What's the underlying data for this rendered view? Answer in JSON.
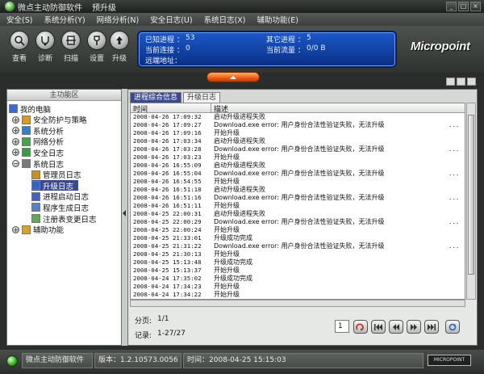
{
  "window": {
    "title": "微点主动防御软件",
    "subtitle": "预升级",
    "buttons": [
      "_",
      "□",
      "×"
    ]
  },
  "menu": [
    "安全(S)",
    "系统分析(Y)",
    "网络分析(N)",
    "安全日志(U)",
    "系统日志(X)",
    "辅助功能(E)"
  ],
  "toolbar": [
    {
      "label": "查看",
      "icon": "search-icon"
    },
    {
      "label": "诊断",
      "icon": "stethoscope-icon"
    },
    {
      "label": "扫描",
      "icon": "scan-icon"
    },
    {
      "label": "设置",
      "icon": "settings-icon"
    },
    {
      "label": "升级",
      "icon": "upgrade-icon"
    }
  ],
  "status_panel": {
    "known_label": "已知进程 ：",
    "known_value": "53",
    "other_label": "其它进程 ：",
    "other_value": "5",
    "conn_label": "当前连接 ：",
    "conn_value": "0",
    "flow_label": "当前流量 ：",
    "flow_value": "0/0 B",
    "remote_label": "远端地址："
  },
  "brand": {
    "logo": "Micropoint"
  },
  "left_panel": {
    "header": "主功能区",
    "tree": [
      {
        "label": "我的电脑",
        "level": 0,
        "expander": "",
        "color": "#3b6bd0"
      },
      {
        "label": "安全防护与策略",
        "level": 1,
        "expander": "+",
        "color": "#d89a26"
      },
      {
        "label": "系统分析",
        "level": 1,
        "expander": "+",
        "color": "#3d7ec9"
      },
      {
        "label": "网络分析",
        "level": 1,
        "expander": "+",
        "color": "#4aa34a"
      },
      {
        "label": "安全日志",
        "level": 1,
        "expander": "+",
        "color": "#3f9a44"
      },
      {
        "label": "系统日志",
        "level": 1,
        "expander": "−",
        "color": "#777a78"
      },
      {
        "label": "管理员日志",
        "level": 2,
        "expander": "",
        "color": "#c2912b"
      },
      {
        "label": "升级日志",
        "level": 2,
        "expander": "",
        "color": "#2f66c6",
        "selected": true
      },
      {
        "label": "进程启动日志",
        "level": 2,
        "expander": "",
        "color": "#4560b8"
      },
      {
        "label": "程序生成日志",
        "level": 2,
        "expander": "",
        "color": "#5a7fc2"
      },
      {
        "label": "注册表变更日志",
        "level": 2,
        "expander": "",
        "color": "#5fa55a"
      },
      {
        "label": "辅助功能",
        "level": 1,
        "expander": "+",
        "color": "#d4a32d"
      }
    ]
  },
  "tabs": [
    {
      "label": "进程综合信息",
      "active": true
    },
    {
      "label": "升级日志",
      "active": false
    }
  ],
  "grid": {
    "columns": [
      "时间",
      "描述"
    ],
    "rows": [
      {
        "time": "2008-04-26 17:09:32",
        "desc": "启动升级进程失败",
        "more": ""
      },
      {
        "time": "2008-04-26 17:09:27",
        "desc": "Download.exe error: 用户身份合法性验证失败，无法升级",
        "more": "..."
      },
      {
        "time": "2008-04-26 17:09:16",
        "desc": "开始升级",
        "more": ""
      },
      {
        "time": "2008-04-26 17:03:34",
        "desc": "启动升级进程失败",
        "more": ""
      },
      {
        "time": "2008-04-26 17:03:28",
        "desc": "Download.exe error: 用户身份合法性验证失败，无法升级",
        "more": "..."
      },
      {
        "time": "2008-04-26 17:03:23",
        "desc": "开始升级",
        "more": ""
      },
      {
        "time": "2008-04-26 16:55:09",
        "desc": "启动升级进程失败",
        "more": ""
      },
      {
        "time": "2008-04-26 16:55:04",
        "desc": "Download.exe error: 用户身份合法性验证失败，无法升级",
        "more": "..."
      },
      {
        "time": "2008-04-26 16:54:55",
        "desc": "开始升级",
        "more": ""
      },
      {
        "time": "2008-04-26 16:51:18",
        "desc": "启动升级进程失败",
        "more": ""
      },
      {
        "time": "2008-04-26 16:51:16",
        "desc": "Download.exe error: 用户身份合法性验证失败，无法升级",
        "more": "..."
      },
      {
        "time": "2008-04-26 16:51:11",
        "desc": "开始升级",
        "more": ""
      },
      {
        "time": "2008-04-25 22:00:31",
        "desc": "启动升级进程失败",
        "more": ""
      },
      {
        "time": "2008-04-25 22:00:29",
        "desc": "Download.exe error: 用户身份合法性验证失败，无法升级",
        "more": "..."
      },
      {
        "time": "2008-04-25 22:00:24",
        "desc": "开始升级",
        "more": ""
      },
      {
        "time": "2008-04-25 21:33:01",
        "desc": "升级成功完成",
        "more": ""
      },
      {
        "time": "2008-04-25 21:31:22",
        "desc": "Download.exe error: 用户身份合法性验证失败，无法升级",
        "more": "..."
      },
      {
        "time": "2008-04-25 21:30:13",
        "desc": "开始升级",
        "more": ""
      },
      {
        "time": "2008-04-25 15:13:48",
        "desc": "升级成功完成",
        "more": ""
      },
      {
        "time": "2008-04-25 15:13:37",
        "desc": "开始升级",
        "more": ""
      },
      {
        "time": "2008-04-24 17:35:02",
        "desc": "升级成功完成",
        "more": ""
      },
      {
        "time": "2008-04-24 17:34:23",
        "desc": "开始升级",
        "more": ""
      },
      {
        "time": "2008-04-24 17:34:22",
        "desc": "开始升级",
        "more": ""
      }
    ]
  },
  "pager": {
    "page_label": "分页:",
    "page_value": "1/1",
    "records_label": "记录:",
    "records_value": "1-27/27",
    "page_input": "1"
  },
  "statusbar": {
    "product": "微点主动防御软件",
    "version_label": "版本：",
    "version": "1.2.10573.0056",
    "time_label": "时间：",
    "time": "2008-04-25 15:15:03",
    "logo": "MICROPOINT"
  }
}
